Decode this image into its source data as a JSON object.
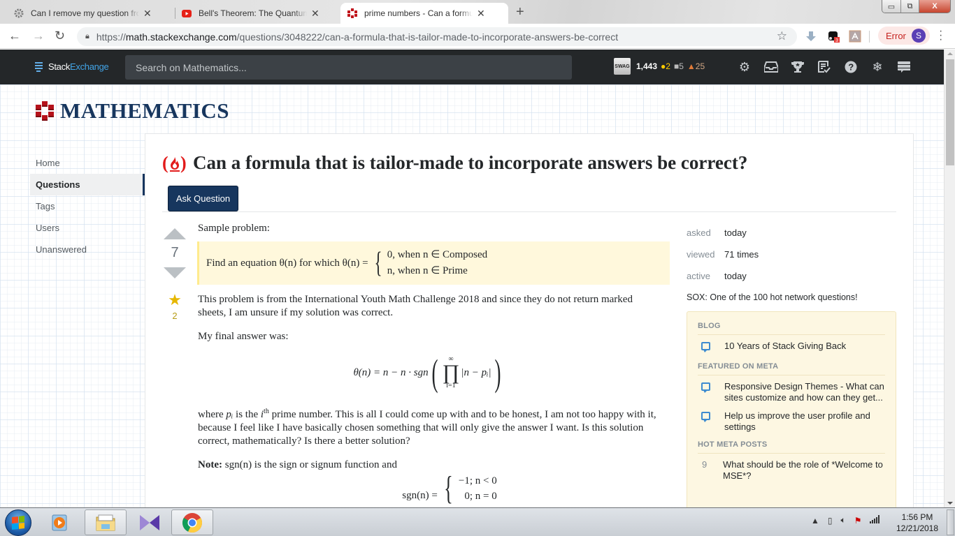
{
  "browser": {
    "tabs": [
      {
        "title": "Can I remove my question from t",
        "favicon": "stackexchange-gear-icon",
        "active": false
      },
      {
        "title": "Bell's Theorem: The Quantum Ve",
        "favicon": "youtube-icon",
        "active": false
      },
      {
        "title": "prime numbers - Can a formula t",
        "favicon": "math-se-icon",
        "active": true
      }
    ],
    "new_tab": "+",
    "close_glyph": "✕",
    "url_prefix": "https://",
    "url_host": "math.stackexchange.com",
    "url_path": "/questions/3048222/can-a-formula-that-is-tailor-made-to-incorporate-answers-be-correct",
    "extension_badge": "3",
    "profile_status": "Error",
    "profile_initial": "S",
    "window_controls": {
      "minimize": "▭",
      "maximize": "⧉",
      "close": "X"
    }
  },
  "topbar": {
    "logo_stack": "Stack",
    "logo_exchange": "Exchange",
    "search_placeholder": "Search on Mathematics...",
    "swag_label": "SWAG",
    "reputation": "1,443",
    "badges": {
      "gold": "2",
      "silver": "5",
      "bronze": "25"
    },
    "icons": [
      "achievements-gear-icon",
      "inbox-icon",
      "trophy-icon",
      "review-queue-icon",
      "help-icon",
      "site-switcher-icon",
      "chat-icon"
    ]
  },
  "site": {
    "name": "MATHEMATICS"
  },
  "leftnav": {
    "items": [
      {
        "label": "Home",
        "active": false
      },
      {
        "label": "Questions",
        "active": true
      },
      {
        "label": "Tags",
        "active": false
      },
      {
        "label": "Users",
        "active": false
      },
      {
        "label": "Unanswered",
        "active": false
      }
    ]
  },
  "question": {
    "title": "Can a formula that is tailor-made to incorporate answers be correct?",
    "hot_badge": "(🔥)",
    "ask_button": "Ask Question",
    "votes": "7",
    "favorites": "2",
    "body": {
      "intro": "Sample problem:",
      "quote_prefix": "Find an equation θ(n) for which θ(n) =",
      "quote_case1": "0, when n ∈ Composed",
      "quote_case2": "n, when n ∈ Prime",
      "para1": "This problem is from the International Youth Math Challenge 2018 and since they do not return marked sheets, I am unsure if my solution was correct.",
      "para2": "My final answer was:",
      "formula_lhs": "θ(n) = n − n · sgn",
      "formula_prod_top": "∞",
      "formula_prod_sym": "∏",
      "formula_prod_bottom": "i=1",
      "formula_inner": "|n − pᵢ|",
      "para3_a": "where ",
      "para3_pi": "pᵢ",
      "para3_b": " is the ",
      "para3_ith": "i",
      "para3_th": "th",
      "para3_c": " prime number. This is all I could come up with and to be honest, I am not too happy with it, because I feel like I have basically chosen something that will only give the answer I want. Is this solution correct, mathematically? Is there a better solution?",
      "note_label": "Note:",
      "note_text": " sgn(n) is the sign or signum function and",
      "sgn_lhs": "sgn(n) =",
      "sgn_case1": "−1;  n < 0",
      "sgn_case2": "0;  n = 0"
    }
  },
  "meta": {
    "asked_label": "asked",
    "asked_value": "today",
    "viewed_label": "viewed",
    "viewed_value": "71 times",
    "active_label": "active",
    "active_value": "today",
    "sox_note": "SOX: One of the 100 hot network questions!"
  },
  "widget": {
    "blog_header": "BLOG",
    "blog_items": [
      "10 Years of Stack Giving Back"
    ],
    "featured_header": "FEATURED ON META",
    "featured_items": [
      "Responsive Design Themes - What can sites customize and how can they get...",
      "Help us improve the user profile and settings"
    ],
    "hot_header": "HOT META POSTS",
    "hot_items": [
      {
        "score": "9",
        "title": "What should be the role of *Welcome to MSE*?"
      }
    ]
  },
  "taskbar": {
    "apps": [
      "windows-start-icon",
      "media-player-icon",
      "file-explorer-icon",
      "visual-studio-icon",
      "chrome-icon"
    ],
    "time": "1:56 PM",
    "date": "12/21/2018"
  }
}
